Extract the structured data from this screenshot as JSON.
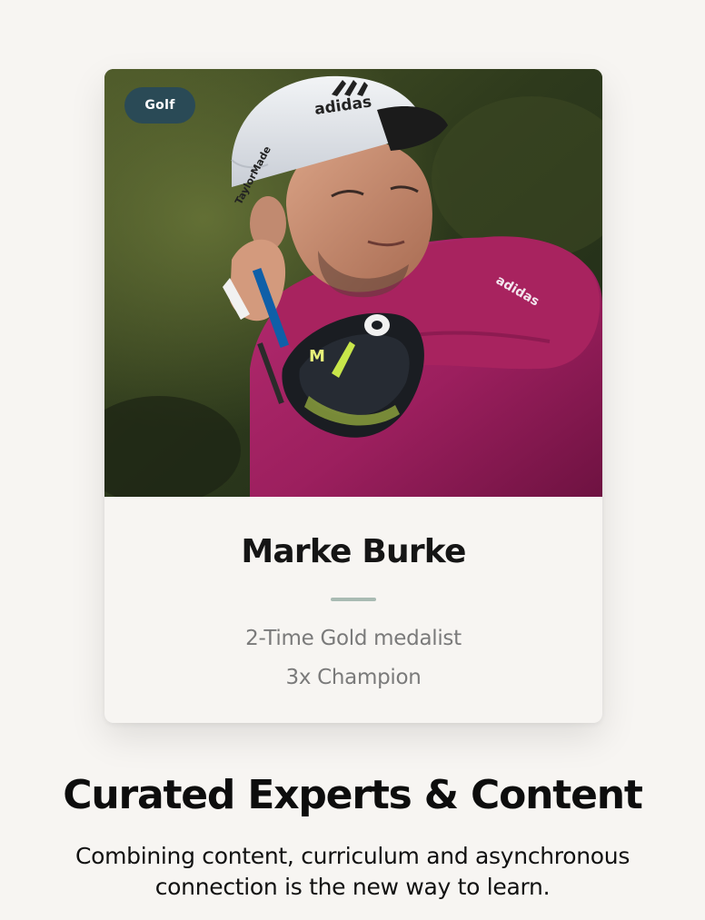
{
  "card": {
    "badge": "Golf",
    "name": "Marke Burke",
    "achievements": [
      "2-Time Gold medalist",
      "3x Champion"
    ],
    "photo": {
      "cap_brand": "adidas",
      "cap_side_text": "TaylorMade",
      "sleeve_text": "adidas"
    }
  },
  "hero": {
    "headline": "Curated Experts & Content",
    "subtitle": "Combining content, curriculum and asynchronous connection is the new way to learn."
  },
  "colors": {
    "background": "#f7f5f2",
    "badge": "#2a4a56",
    "divider": "#a9bbb3",
    "shirt": "#9c1f5e",
    "name_text": "#151515",
    "achievement_text": "#7a7a7a"
  }
}
